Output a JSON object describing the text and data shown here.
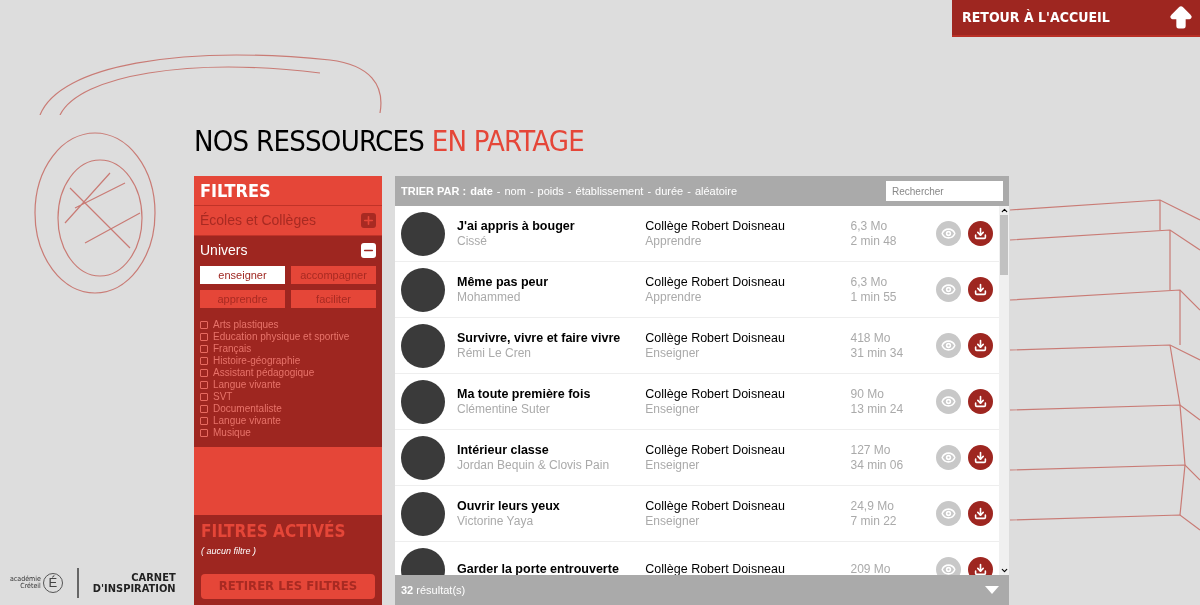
{
  "home_button": {
    "label": "RETOUR À L'ACCUEIL"
  },
  "page_title": {
    "main": "NOS RESSOURCES",
    "accent": "EN PARTAGE"
  },
  "filters": {
    "title": "FILTRES",
    "sections": [
      {
        "label": "Écoles et Collèges",
        "expanded": false
      },
      {
        "label": "Univers",
        "expanded": true,
        "tags": [
          {
            "label": "enseigner",
            "selected": true
          },
          {
            "label": "accompagner",
            "selected": false
          },
          {
            "label": "apprendre",
            "selected": false
          },
          {
            "label": "faciliter",
            "selected": false
          }
        ],
        "subjects": [
          {
            "label": "Arts plastiques",
            "checked": false
          },
          {
            "label": "Education physique et sportive",
            "checked": false
          },
          {
            "label": "Français",
            "checked": false
          },
          {
            "label": "Histoire-géographie",
            "checked": false
          },
          {
            "label": "Assistant pédagogique",
            "checked": false
          },
          {
            "label": "Langue vivante",
            "checked": false
          },
          {
            "label": "SVT",
            "checked": false
          },
          {
            "label": "Documentaliste",
            "checked": false
          },
          {
            "label": "Langue vivante",
            "checked": false
          },
          {
            "label": "Musique",
            "checked": false
          }
        ]
      }
    ],
    "active_title": "FILTRES ACTIVÉS",
    "active_none": "( aucun filtre )",
    "clear_button": "RETIRER LES FILTRES"
  },
  "sort": {
    "label": "TRIER PAR :",
    "separator": "-",
    "options": [
      {
        "label": "date",
        "selected": true
      },
      {
        "label": "nom",
        "selected": false
      },
      {
        "label": "poids",
        "selected": false
      },
      {
        "label": "établissement",
        "selected": false
      },
      {
        "label": "durée",
        "selected": false
      },
      {
        "label": "aléatoire",
        "selected": false
      }
    ]
  },
  "search": {
    "placeholder": "Rechercher"
  },
  "resources": [
    {
      "title": "J'ai appris à bouger",
      "author": "Cissé",
      "school": "Collège Robert Doisneau",
      "category": "Apprendre",
      "size": "6,3 Mo",
      "duration": "2 min 48"
    },
    {
      "title": "Même pas peur",
      "author": "Mohammed",
      "school": "Collège Robert Doisneau",
      "category": "Apprendre",
      "size": "6,3 Mo",
      "duration": "1 min 55"
    },
    {
      "title": "Survivre, vivre et faire vivre",
      "author": "Rémi Le Cren",
      "school": "Collège Robert Doisneau",
      "category": "Enseigner",
      "size": "418 Mo",
      "duration": "31 min 34"
    },
    {
      "title": "Ma toute première fois",
      "author": "Clémentine Suter",
      "school": "Collège Robert Doisneau",
      "category": "Enseigner",
      "size": "90 Mo",
      "duration": "13 min 24"
    },
    {
      "title": "Intérieur classe",
      "author": "Jordan Bequin & Clovis Pain",
      "school": "Collège Robert Doisneau",
      "category": "Enseigner",
      "size": "127 Mo",
      "duration": "34 min 06"
    },
    {
      "title": "Ouvrir leurs yeux",
      "author": "Victorine Yaya",
      "school": "Collège Robert Doisneau",
      "category": "Enseigner",
      "size": "24,9 Mo",
      "duration": "7 min 22"
    },
    {
      "title": "Garder la porte entrouverte",
      "school": "Collège Robert Doisneau",
      "size": "209 Mo"
    }
  ],
  "results": {
    "count": "32",
    "label": "résultat(s)"
  },
  "logo": {
    "academy_line1": "académie",
    "academy_line2": "Créteil",
    "academy_letter": "É",
    "brand_line1": "CARNET",
    "brand_line2": "D'INSPIRATION"
  }
}
